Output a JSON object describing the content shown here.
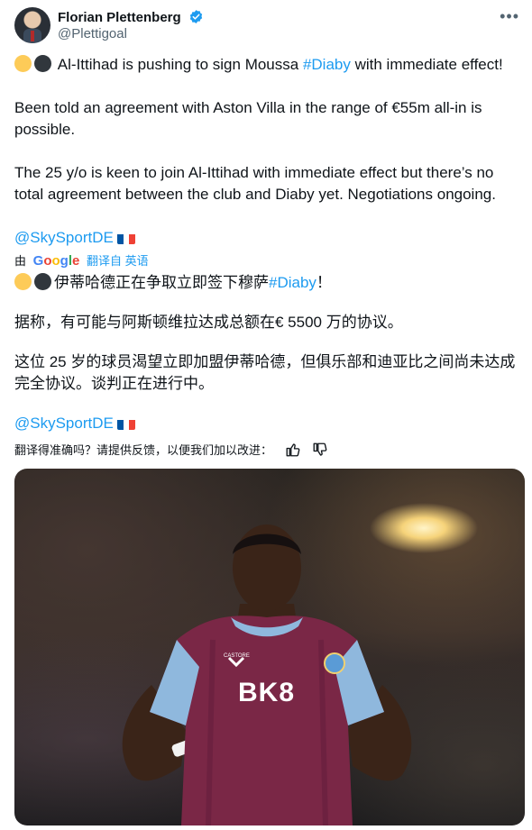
{
  "author": {
    "name": "Florian Plettenberg",
    "handle": "@Plettigoal"
  },
  "tweet_en": {
    "line1": "Al-Ittihad is pushing to sign Moussa ",
    "hashtag": "#Diaby",
    "line1_end": " with immediate effect!",
    "para2": "Been told an agreement with Aston Villa in the range of €55m all-in is possible.",
    "para3": "The 25 y/o is keen to join Al-Ittihad with immediate effect but there’s no total agreement between the club and Diaby yet. Negotiations ongoing.",
    "mention": "@SkySportDE"
  },
  "translation_bar": {
    "by": "由",
    "google": "Google",
    "translated_from": "翻译自 英语"
  },
  "tweet_zh": {
    "line1": "伊蒂哈德正在争取立即签下穆萨",
    "hashtag": "#Diaby",
    "line1_end": "！",
    "para2": "据称，有可能与阿斯顿维拉达成总额在€ 5500 万的协议。",
    "para3": "这位 25 岁的球员渴望立即加盟伊蒂哈德，但俱乐部和迪亚比之间尚未达成完全协议。谈判正在进行中。",
    "mention": "@SkySportDE"
  },
  "feedback": {
    "prompt": "翻译得准确吗？请提供反馈，以便我们加以改进："
  },
  "photo": {
    "sponsor": "BK8",
    "kit_brand": "CASTORE"
  },
  "colors": {
    "link": "#1d9bf0",
    "text": "#0f1419",
    "muted": "#536471",
    "claret": "#7a2746",
    "sky_blue": "#8fb8dd"
  }
}
